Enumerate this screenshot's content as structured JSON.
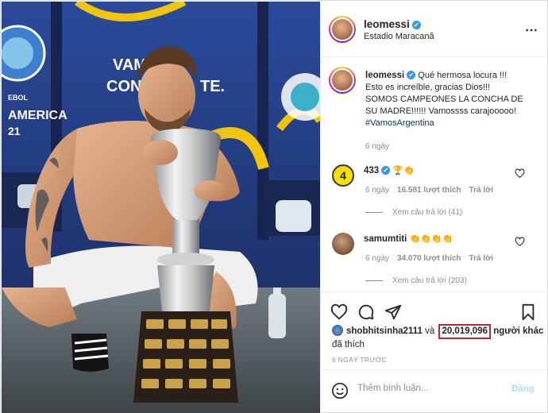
{
  "post": {
    "username": "leomessi",
    "location": "Estadio Maracanã",
    "more_icon": "⋯",
    "caption_username": "leomessi",
    "caption_lines": [
      "Qué hermosa locura !!!",
      "Esto es increíble, gracias Dios!!!",
      "SOMOS CAMPEONES LA CONCHA DE",
      "SU MADRE!!!!!! Vamossss carajooooo!"
    ],
    "hashtag": "#VamosArgentina",
    "caption_time": "6 ngày"
  },
  "photo": {
    "banner_top": "VAMOS",
    "banner_bottom": "CON TODO",
    "banner_suffix": "TE.",
    "left_text_1": "EBOL",
    "left_text_2": "AMERICA",
    "left_text_3": "21"
  },
  "comments": [
    {
      "username": "433",
      "text": "🏆👏",
      "time": "6 ngày",
      "likes": "16.581 lượt thích",
      "reply": "Trả lời",
      "view_replies": "Xem câu trả lời (41)"
    },
    {
      "username": "samumtiti",
      "text": "👏👏👏👏",
      "time": "6 ngày",
      "likes": "34.070 lượt thích",
      "reply": "Trả lời",
      "view_replies": "Xem câu trả lời (203)"
    }
  ],
  "likes_line": {
    "first_user": "shobhitsinha2111",
    "connector": "và",
    "count": "20,019,096",
    "suffix": "người khác",
    "line2": "đã thích"
  },
  "time_ago": "6 NGÀY TRƯỚC",
  "add_comment": {
    "placeholder": "Thêm bình luận...",
    "post_label": "Đăng"
  },
  "colors": {
    "accent_blue": "#0095f6",
    "verified": "#3897f0",
    "highlight_box": "#c0272d",
    "photo_background": "#243b78"
  },
  "icons": [
    "verified-icon",
    "more-options-icon",
    "heart-icon",
    "comment-icon",
    "share-icon",
    "bookmark-icon",
    "emoji-icon"
  ]
}
